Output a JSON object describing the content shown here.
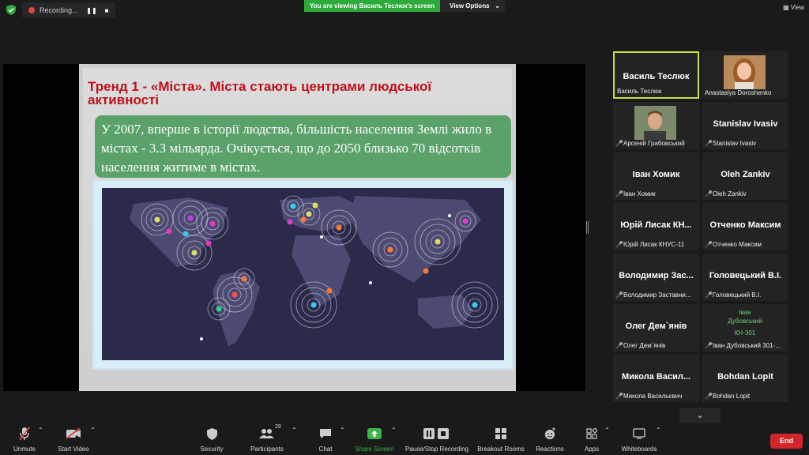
{
  "topbar": {
    "recording_label": "Recording...",
    "viewing_banner": "You are viewing Василь Теслюк's screen",
    "view_options_label": "View Options",
    "view_label": "View"
  },
  "slide": {
    "title": "Тренд 1 - «Міста». Міста стають центрами людської активності",
    "body": "У 2007, вперше в історії людства, більшість населення Землі жило в містах - 3.3 мільярда. Очікується, що до 2050 близько 70 відсотків населення житиме в містах."
  },
  "participants": [
    {
      "name": "Василь Теслюк",
      "label": "Василь Теслюк",
      "muted": false,
      "active": true,
      "view": "name"
    },
    {
      "name": "",
      "label": "Anastasiya Doroshenko",
      "muted": false,
      "active": false,
      "view": "photo-woman"
    },
    {
      "name": "",
      "label": "Арсеній Грабовський",
      "muted": true,
      "active": false,
      "view": "photo-man"
    },
    {
      "name": "Stanislav Ivasiv",
      "label": "Stanislav Ivasiv",
      "muted": true,
      "active": false,
      "view": "name"
    },
    {
      "name": "Іван Хомик",
      "label": "Іван Хомик",
      "muted": true,
      "active": false,
      "view": "name"
    },
    {
      "name": "Oleh Zankiv",
      "label": "Oleh Zankiv",
      "muted": true,
      "active": false,
      "view": "name"
    },
    {
      "name": "Юрій Лисак КН...",
      "label": "Юрій Лисак КНУС-11",
      "muted": true,
      "active": false,
      "view": "name"
    },
    {
      "name": "Отченко Максим",
      "label": "Отченко Максим",
      "muted": true,
      "active": false,
      "view": "name"
    },
    {
      "name": "Володимир Зас...",
      "label": "Володимир Заставни...",
      "muted": true,
      "active": false,
      "view": "name"
    },
    {
      "name": "Головецький В.І.",
      "label": "Головецький В.І.",
      "muted": true,
      "active": false,
      "view": "name"
    },
    {
      "name": "Олег Дем`янів",
      "label": "Олег Дем`янів",
      "muted": true,
      "active": false,
      "view": "name"
    },
    {
      "name": "Іван Дубовський КН-301",
      "label": "Іван Дубовський 301-...",
      "muted": true,
      "active": false,
      "view": "green-text",
      "green_lines": [
        "Іван",
        "Дубовський",
        "КН-301"
      ]
    },
    {
      "name": "Микола Васил...",
      "label": "Микола Васильєвич",
      "muted": true,
      "active": false,
      "view": "name"
    },
    {
      "name": "Bohdan Lopit",
      "label": "Bohdan Lopit",
      "muted": true,
      "active": false,
      "view": "name"
    }
  ],
  "toolbar": {
    "unmute": "Unmute",
    "start_video": "Start Video",
    "security": "Security",
    "participants": "Participants",
    "participants_count": "29",
    "chat": "Chat",
    "share_screen": "Share Screen",
    "pause_recording": "Pause/Stop Recording",
    "breakout_rooms": "Breakout Rooms",
    "reactions": "Reactions",
    "apps": "Apps",
    "whiteboards": "Whiteboards",
    "end": "End"
  },
  "colors": {
    "banner_green": "#2dab3a",
    "active_border": "#c8e13c",
    "end_red": "#d3262a",
    "slide_title_red": "#c0111a",
    "slide_box_green": "#5aa26a"
  }
}
